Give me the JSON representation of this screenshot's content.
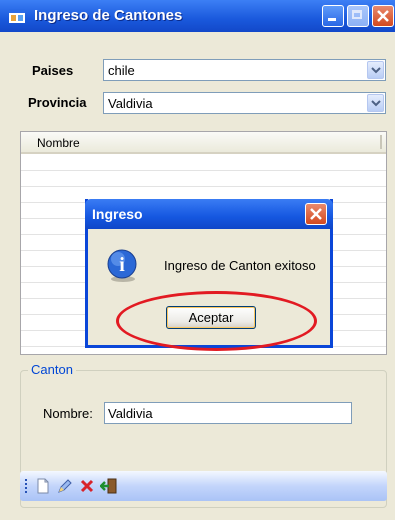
{
  "window": {
    "title": "Ingreso de Cantones"
  },
  "form": {
    "paises_label": "Paises",
    "paises_value": "chile",
    "provincia_label": "Provincia",
    "provincia_value": "Valdivia"
  },
  "grid": {
    "column_header": "Nombre"
  },
  "canton_group": {
    "title": "Canton",
    "nombre_label": "Nombre:",
    "nombre_value": "Valdivia"
  },
  "toolbar": {
    "icons": [
      "new-icon",
      "edit-icon",
      "delete-icon",
      "exit-icon"
    ]
  },
  "dialog": {
    "title": "Ingreso",
    "message": "Ingreso de Canton exitoso",
    "ok_label": "Aceptar"
  },
  "colors": {
    "highlight": "#e21a22",
    "title_bar": "#1a59dc",
    "group_title": "#0046d5"
  }
}
